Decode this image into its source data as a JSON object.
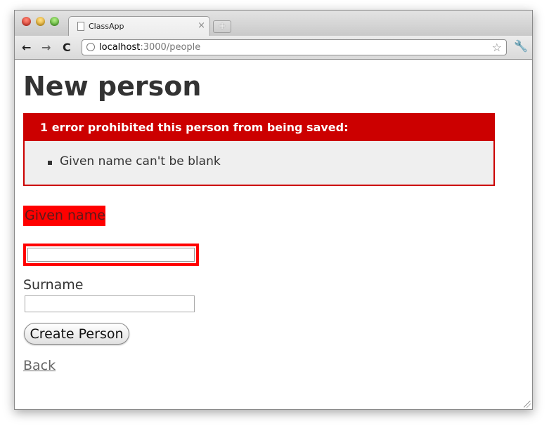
{
  "browser": {
    "tab_title": "ClassApp",
    "tab_close": "×",
    "new_tab": "+",
    "url_host": "localhost",
    "url_rest": ":3000/people",
    "back_glyph": "←",
    "forward_glyph": "→",
    "reload_glyph": "C",
    "star_glyph": "☆",
    "wrench_glyph": "🔧"
  },
  "page": {
    "title": "New person",
    "error_header": "1 error prohibited this person from being saved:",
    "errors": [
      "Given name can't be blank"
    ],
    "fields": {
      "given_name_label": "Given name",
      "given_name_value": "",
      "surname_label": "Surname",
      "surname_value": ""
    },
    "submit_label": "Create Person",
    "back_link": "Back"
  },
  "colors": {
    "error_red": "#cc0000",
    "field_error_red": "#ff0000",
    "error_box_bg": "#efefef"
  }
}
